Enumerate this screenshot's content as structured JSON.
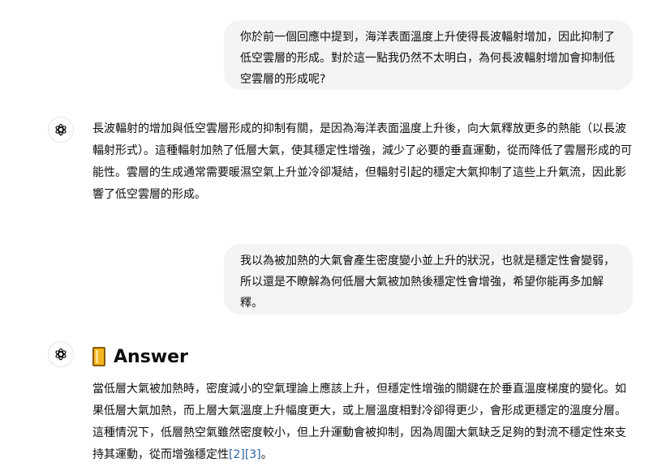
{
  "conversation": {
    "user_message_1": "你於前一個回應中提到，海洋表面溫度上升使得長波輻射增加，因此抑制了低空雲層的形成。對於這一點我仍然不太明白，為何長波輻射增加會抑制低空雲層的形成呢?",
    "assistant_message_1": "長波輻射的增加與低空雲層形成的抑制有關，是因為海洋表面溫度上升後，向大氣釋放更多的熱能（以長波輻射形式）。這種輻射加熱了低層大氣，使其穩定性增強，減少了必要的垂直運動，從而降低了雲層形成的可能性。雲層的生成通常需要暖濕空氣上升並冷卻凝結，但輻射引起的穩定大氣抑制了這些上升氣流，因此影響了低空雲層的形成。",
    "user_message_2": "我以為被加熱的大氣會產生密度變小並上升的狀況，也就是穩定性會變弱，所以還是不瞭解為何低層大氣被加熱後穩定性會增強，希望你能再多加解釋。",
    "assistant_heading_2": "Answer",
    "assistant_message_2": "當低層大氣被加熱時，密度減小的空氣理論上應該上升，但穩定性增強的關鍵在於垂直溫度梯度的變化。如果低層大氣加熱，而上層大氣溫度上升幅度更大，或上層溫度相對冷卻得更少，會形成更穩定的溫度分層。這種情況下，低層熱空氣雖然密度較小，但上升運動會被抑制，因為周圍大氣缺乏足夠的對流不穩定性來支持其運動，從而增強穩定性",
    "citation_1": "[2]",
    "citation_2": "[3]",
    "end_punct": "。"
  },
  "icons": {
    "assistant_avatar": "openai-logo-icon",
    "answer_heading": "yellow-book-icon"
  },
  "colors": {
    "user_bubble_bg": "#f4f4f4",
    "citation": "#2964aa",
    "text": "#0d0d0d"
  }
}
